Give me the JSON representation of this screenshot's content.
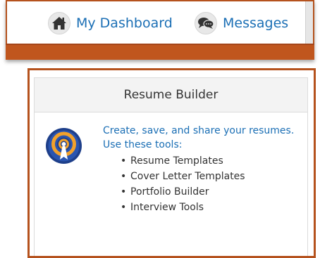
{
  "nav": {
    "dashboard": {
      "label": "My Dashboard",
      "icon": "home-icon"
    },
    "messages": {
      "label": "Messages",
      "icon": "chat-bubbles-icon"
    }
  },
  "resume_builder": {
    "title": "Resume Builder",
    "icon": "resume-builder-icon",
    "description_line1": "Create, save, and share your resumes.",
    "description_line2": "Use these tools:",
    "tools": [
      "Resume Templates",
      "Cover Letter Templates",
      "Portfolio Builder",
      "Interview Tools"
    ]
  },
  "colors": {
    "accent_orange": "#c0561e",
    "link_blue": "#1b6fb5",
    "icon_navy": "#1e3f8a"
  }
}
